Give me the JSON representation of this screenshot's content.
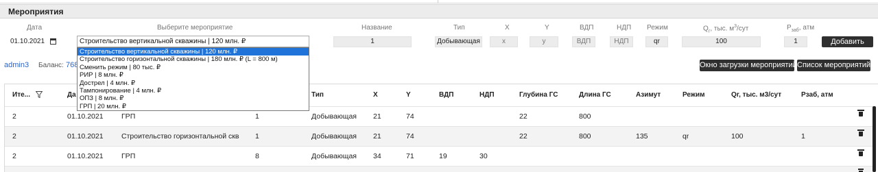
{
  "panel": {
    "title": "Мероприятия"
  },
  "form": {
    "labels": {
      "date": "Дата",
      "select": "Выберите мероприятие",
      "name": "Название",
      "type": "Тип",
      "x": "X",
      "y": "Y",
      "vdp": "ВДП",
      "ndp": "НДП",
      "mode": "Режим",
      "q_main": "Q",
      "q_sub": "г",
      "q_rest": ", тыс. м",
      "q_sup": "3",
      "q_tail": "/сут",
      "p_main": "P",
      "p_sub": "заб",
      "p_tail": ", атм"
    },
    "date_value": "01.10.2021",
    "selected_event": "Строительство вертикальной скважины | 120 млн. ₽",
    "name_value": "1",
    "type_value": "Добывающая",
    "x_placeholder": "x",
    "y_placeholder": "y",
    "vdp_placeholder": "ВДП",
    "ndp_placeholder": "НДП",
    "mode_value": "qr",
    "q_value": "100",
    "p_value": "1",
    "add_button": "Добавить"
  },
  "dropdown": {
    "options": [
      "Строительство вертикальной скважины | 120 млн. ₽",
      "Строительство горизонтальной скважины | 180 млн. ₽ (L = 800 м)",
      "Сменить режим | 80 тыс. ₽",
      "РИР | 8 млн. ₽",
      "Дострел | 4 млн. ₽",
      "Тампонирование | 4 млн. ₽",
      "ОПЗ | 8 млн. ₽",
      "ГРП | 20 млн. ₽"
    ],
    "selected_index": 0
  },
  "user": {
    "name": "admin3",
    "balance_label": "Баланс:",
    "balance_value": "768"
  },
  "actions": {
    "upload_window": "Окно загрузки мероприятий",
    "events_list": "Список мероприятий"
  },
  "table": {
    "headers": [
      "Ите...",
      "Да",
      "Тип",
      "X",
      "Y",
      "ВДП",
      "НДП",
      "Глубина ГС",
      "Длина ГС",
      "Азимут",
      "Режим",
      "Qr, тыс. м3/сут",
      "Рзаб, атм"
    ],
    "rows": [
      {
        "iter": "2",
        "date": "01.10.2021",
        "event": "ГРП",
        "name": "1",
        "type": "Добывающая",
        "x": "21",
        "y": "74",
        "vdp": "",
        "ndp": "",
        "depth": "22",
        "length": "800",
        "azimuth": "",
        "mode": "",
        "q": "",
        "p": ""
      },
      {
        "iter": "2",
        "date": "01.10.2021",
        "event": "Строительство горизонтальной сква...",
        "name": "1",
        "type": "Добывающая",
        "x": "21",
        "y": "74",
        "vdp": "",
        "ndp": "",
        "depth": "22",
        "length": "800",
        "azimuth": "135",
        "mode": "qr",
        "q": "100",
        "p": "1"
      },
      {
        "iter": "2",
        "date": "01.10.2021",
        "event": "ГРП",
        "name": "8",
        "type": "Добывающая",
        "x": "34",
        "y": "71",
        "vdp": "19",
        "ndp": "30",
        "depth": "",
        "length": "",
        "azimuth": "",
        "mode": "",
        "q": "",
        "p": ""
      }
    ]
  },
  "icons": {
    "filter": "filter-icon",
    "delete": "trash-icon",
    "calendar": "calendar-icon"
  },
  "colors": {
    "accent": "#1f73d9",
    "button": "#2f2f2f",
    "link": "#2a64c8"
  }
}
